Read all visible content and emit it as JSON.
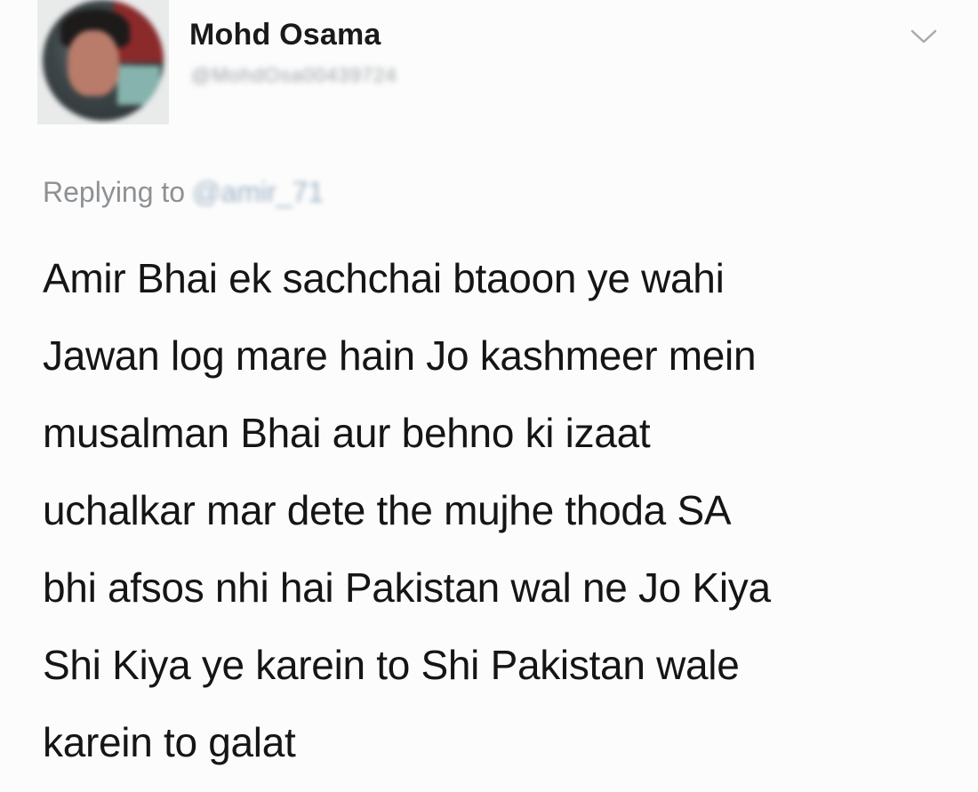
{
  "tweet": {
    "author": {
      "name": "Mohd Osama",
      "handle": "@MohdOsa00439724",
      "avatar_icon": "user-avatar"
    },
    "menu_icon": "chevron-down-icon",
    "replying_to": {
      "label": "Replying to",
      "mention": "@amir_71"
    },
    "text_lines": [
      "Amir Bhai ek sachchai btaoon ye wahi",
      "Jawan log mare hain Jo kashmeer mein",
      "musalman Bhai aur behno ki izaat",
      "uchalkar mar dete the mujhe thoda SA",
      "bhi afsos nhi hai Pakistan wal ne Jo Kiya",
      "Shi Kiya ye karein to Shi Pakistan wale",
      "karein to galat"
    ]
  },
  "colors": {
    "background": "#fcfcfc",
    "text": "#151515",
    "secondary_text": "#8d9194",
    "mention": "#9fb3c4"
  }
}
